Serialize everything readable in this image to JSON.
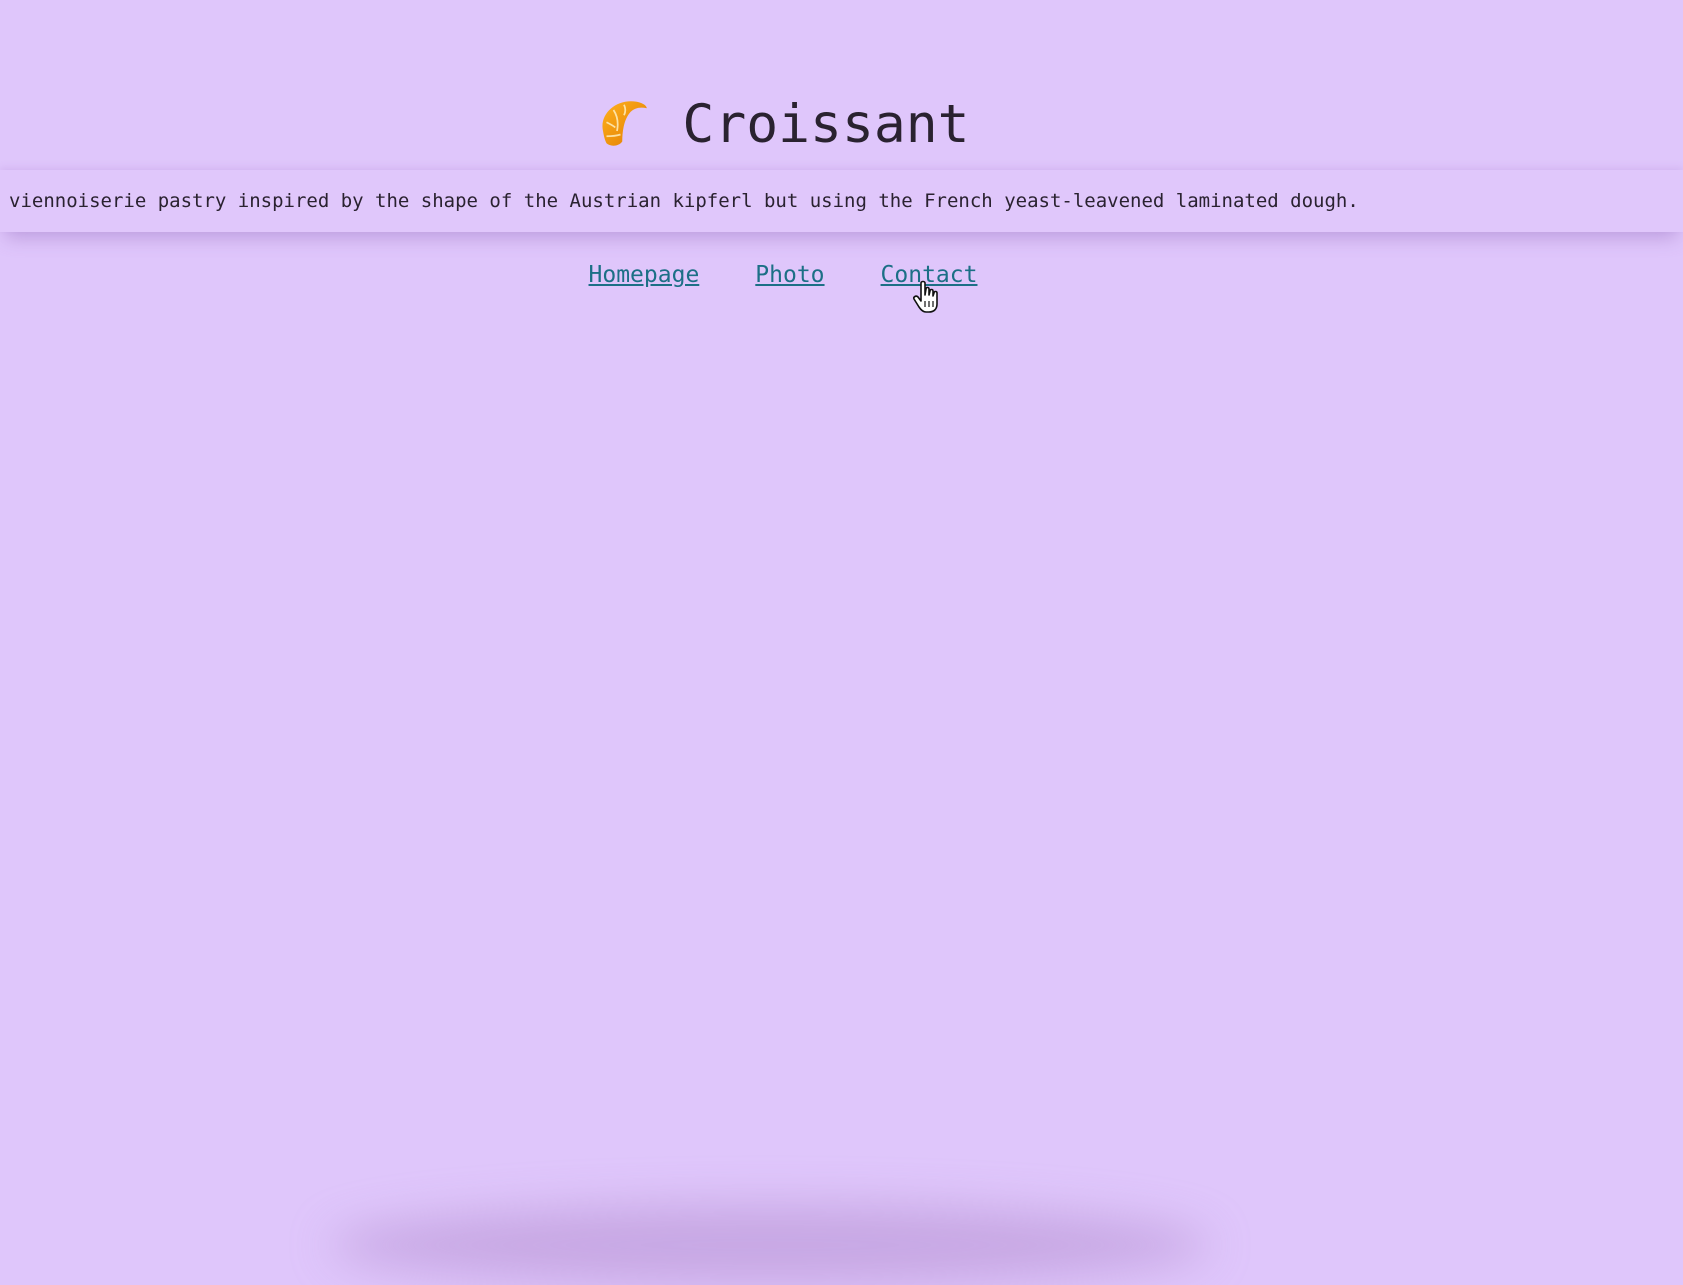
{
  "header": {
    "logo_icon": "croissant-icon",
    "title": "Croissant"
  },
  "banner": {
    "text": "viennoiserie pastry inspired by the shape of the Austrian kipferl but using the French yeast-leavened laminated dough."
  },
  "nav": {
    "items": [
      {
        "label": "Homepage"
      },
      {
        "label": "Photo"
      },
      {
        "label": "Contact"
      }
    ]
  },
  "colors": {
    "background": "#dfc6fb",
    "link": "#1c6f86",
    "text": "#2a2230"
  },
  "cursor_icon": "hand-pointer-icon"
}
